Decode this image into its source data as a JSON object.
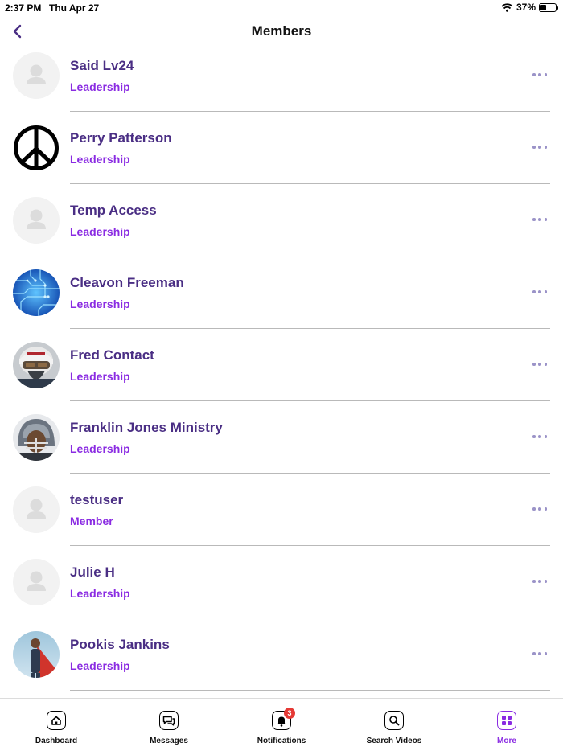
{
  "status_bar": {
    "time": "2:37 PM",
    "date": "Thu Apr 27",
    "battery": "37%",
    "battery_level": 0.37
  },
  "header": {
    "title": "Members"
  },
  "members": [
    {
      "name": "Said Lv24",
      "role": "Leadership",
      "avatar": "placeholder"
    },
    {
      "name": "Perry Patterson",
      "role": "Leadership",
      "avatar": "peace-sign"
    },
    {
      "name": "Temp Access",
      "role": "Leadership",
      "avatar": "placeholder"
    },
    {
      "name": "Cleavon Freeman",
      "role": "Leadership",
      "avatar": "circuit-board-photo"
    },
    {
      "name": "Fred Contact",
      "role": "Leadership",
      "avatar": "pilot-photo"
    },
    {
      "name": "Franklin Jones Ministry",
      "role": "Leadership",
      "avatar": "football-player-photo"
    },
    {
      "name": "testuser",
      "role": "Member",
      "avatar": "placeholder"
    },
    {
      "name": "Julie H",
      "role": "Leadership",
      "avatar": "placeholder"
    },
    {
      "name": "Pookis Jankins",
      "role": "Leadership",
      "avatar": "superhero-photo"
    }
  ],
  "tabs": [
    {
      "label": "Dashboard",
      "icon": "home-icon"
    },
    {
      "label": "Messages",
      "icon": "chat-icon"
    },
    {
      "label": "Notifications",
      "icon": "bell-icon",
      "badge": "3"
    },
    {
      "label": "Search Videos",
      "icon": "search-icon"
    },
    {
      "label": "More",
      "icon": "grid-icon",
      "active": true
    }
  ],
  "colors": {
    "accent": "#8a2be2",
    "name_text": "#4a2e84",
    "badge": "#e53935"
  }
}
